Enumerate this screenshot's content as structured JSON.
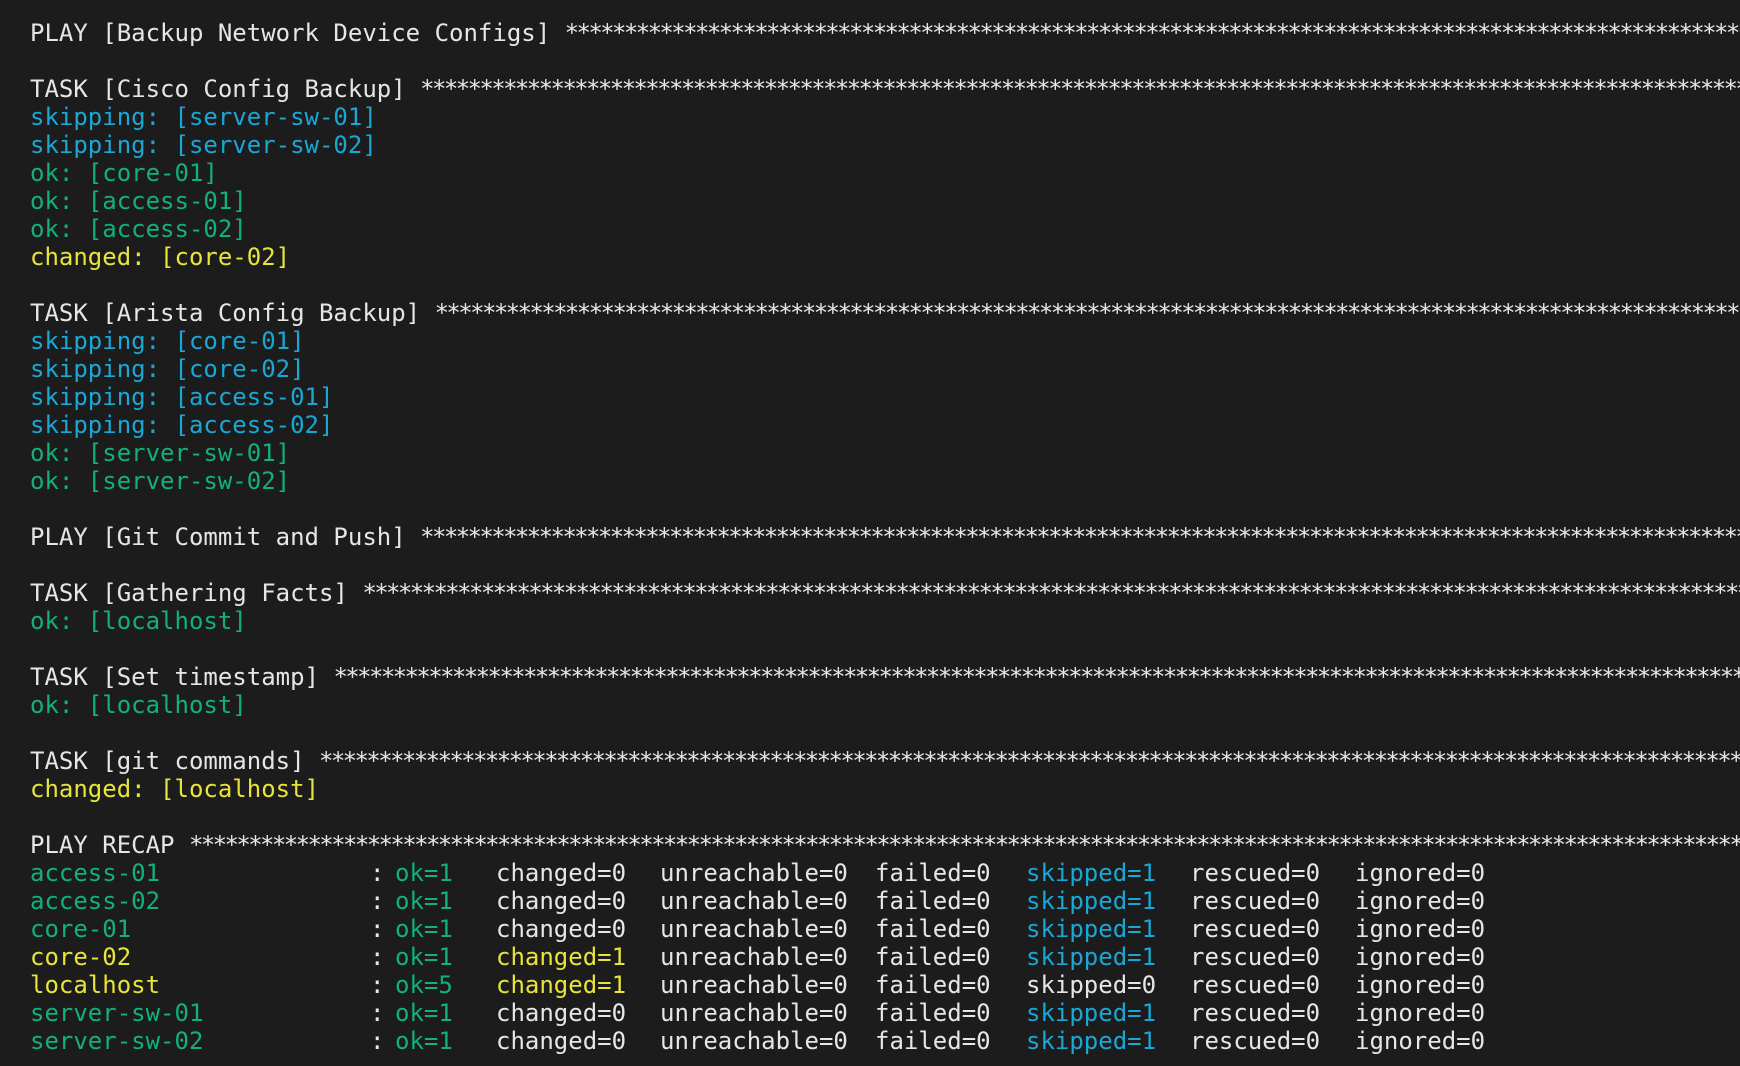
{
  "colors": {
    "background": "#1c1c1c",
    "default": "#e6e6e6",
    "skipping": "#19a7d6",
    "ok": "#12b07a",
    "changed": "#e8e43a"
  },
  "star_fill": "************************************************************************************************************************************************************************************",
  "sections": [
    {
      "kind": "header",
      "text": "PLAY [Backup Network Device Configs] "
    },
    {
      "kind": "blank"
    },
    {
      "kind": "header",
      "text": "TASK [Cisco Config Backup] "
    },
    {
      "kind": "result",
      "status": "skipping",
      "text": "skipping: [server-sw-01]"
    },
    {
      "kind": "result",
      "status": "skipping",
      "text": "skipping: [server-sw-02]"
    },
    {
      "kind": "result",
      "status": "ok",
      "text": "ok: [core-01]"
    },
    {
      "kind": "result",
      "status": "ok",
      "text": "ok: [access-01]"
    },
    {
      "kind": "result",
      "status": "ok",
      "text": "ok: [access-02]"
    },
    {
      "kind": "result",
      "status": "changed",
      "text": "changed: [core-02]"
    },
    {
      "kind": "blank"
    },
    {
      "kind": "header",
      "text": "TASK [Arista Config Backup] "
    },
    {
      "kind": "result",
      "status": "skipping",
      "text": "skipping: [core-01]"
    },
    {
      "kind": "result",
      "status": "skipping",
      "text": "skipping: [core-02]"
    },
    {
      "kind": "result",
      "status": "skipping",
      "text": "skipping: [access-01]"
    },
    {
      "kind": "result",
      "status": "skipping",
      "text": "skipping: [access-02]"
    },
    {
      "kind": "result",
      "status": "ok",
      "text": "ok: [server-sw-01]"
    },
    {
      "kind": "result",
      "status": "ok",
      "text": "ok: [server-sw-02]"
    },
    {
      "kind": "blank"
    },
    {
      "kind": "header",
      "text": "PLAY [Git Commit and Push] "
    },
    {
      "kind": "blank"
    },
    {
      "kind": "header",
      "text": "TASK [Gathering Facts] "
    },
    {
      "kind": "result",
      "status": "ok",
      "text": "ok: [localhost]"
    },
    {
      "kind": "blank"
    },
    {
      "kind": "header",
      "text": "TASK [Set timestamp] "
    },
    {
      "kind": "result",
      "status": "ok",
      "text": "ok: [localhost]"
    },
    {
      "kind": "blank"
    },
    {
      "kind": "header",
      "text": "TASK [git commands] "
    },
    {
      "kind": "result",
      "status": "changed",
      "text": "changed: [localhost]"
    },
    {
      "kind": "blank"
    },
    {
      "kind": "header",
      "text": "PLAY RECAP "
    }
  ],
  "recap": [
    {
      "host": "access-01",
      "host_status": "ok",
      "colon": ":",
      "ok": "ok=1",
      "changed": "changed=0",
      "changed_hl": false,
      "unreachable": "unreachable=0",
      "failed": "failed=0",
      "skipped": "skipped=1",
      "skipped_hl": true,
      "rescued": "rescued=0",
      "ignored": "ignored=0"
    },
    {
      "host": "access-02",
      "host_status": "ok",
      "colon": ":",
      "ok": "ok=1",
      "changed": "changed=0",
      "changed_hl": false,
      "unreachable": "unreachable=0",
      "failed": "failed=0",
      "skipped": "skipped=1",
      "skipped_hl": true,
      "rescued": "rescued=0",
      "ignored": "ignored=0"
    },
    {
      "host": "core-01",
      "host_status": "ok",
      "colon": ":",
      "ok": "ok=1",
      "changed": "changed=0",
      "changed_hl": false,
      "unreachable": "unreachable=0",
      "failed": "failed=0",
      "skipped": "skipped=1",
      "skipped_hl": true,
      "rescued": "rescued=0",
      "ignored": "ignored=0"
    },
    {
      "host": "core-02",
      "host_status": "changed",
      "colon": ":",
      "ok": "ok=1",
      "changed": "changed=1",
      "changed_hl": true,
      "unreachable": "unreachable=0",
      "failed": "failed=0",
      "skipped": "skipped=1",
      "skipped_hl": true,
      "rescued": "rescued=0",
      "ignored": "ignored=0"
    },
    {
      "host": "localhost",
      "host_status": "changed",
      "colon": ":",
      "ok": "ok=5",
      "changed": "changed=1",
      "changed_hl": true,
      "unreachable": "unreachable=0",
      "failed": "failed=0",
      "skipped": "skipped=0",
      "skipped_hl": false,
      "rescued": "rescued=0",
      "ignored": "ignored=0"
    },
    {
      "host": "server-sw-01",
      "host_status": "ok",
      "colon": ":",
      "ok": "ok=1",
      "changed": "changed=0",
      "changed_hl": false,
      "unreachable": "unreachable=0",
      "failed": "failed=0",
      "skipped": "skipped=1",
      "skipped_hl": true,
      "rescued": "rescued=0",
      "ignored": "ignored=0"
    },
    {
      "host": "server-sw-02",
      "host_status": "ok",
      "colon": ":",
      "ok": "ok=1",
      "changed": "changed=0",
      "changed_hl": false,
      "unreachable": "unreachable=0",
      "failed": "failed=0",
      "skipped": "skipped=1",
      "skipped_hl": true,
      "rescued": "rescued=0",
      "ignored": "ignored=0"
    }
  ]
}
